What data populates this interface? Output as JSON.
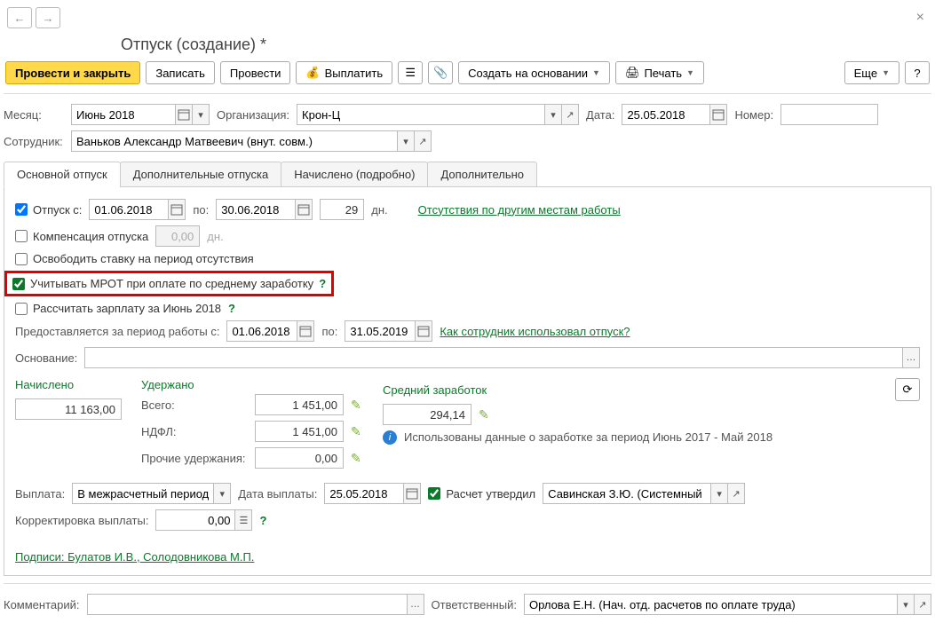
{
  "header": {
    "title": "Отпуск (создание) *"
  },
  "actions": {
    "post_close": "Провести и закрыть",
    "save": "Записать",
    "post": "Провести",
    "pay": "Выплатить",
    "create_based": "Создать на основании",
    "print": "Печать",
    "more": "Еще",
    "help": "?"
  },
  "topfields": {
    "month_l": "Месяц:",
    "month_v": "Июнь 2018",
    "org_l": "Организация:",
    "org_v": "Крон-Ц",
    "date_l": "Дата:",
    "date_v": "25.05.2018",
    "num_l": "Номер:",
    "emp_l": "Сотрудник:",
    "emp_v": "Ваньков Александр Матвеевич (внут. совм.)"
  },
  "tabs": {
    "main": "Основной отпуск",
    "add": "Дополнительные отпуска",
    "calc": "Начислено (подробно)",
    "other": "Дополнительно"
  },
  "main": {
    "vacation_l": "Отпуск  с:",
    "from": "01.06.2018",
    "to_l": "по:",
    "to": "30.06.2018",
    "days": "29",
    "days_l": "дн.",
    "absence_link": "Отсутствия по другим местам работы",
    "comp_l": "Компенсация отпуска",
    "comp_v": "0,00",
    "comp_u": "дн.",
    "release_l": "Освободить ставку на период отсутствия",
    "mrot_l": "Учитывать МРОТ при оплате по среднему заработку",
    "recalc_l": "Рассчитать зарплату за Июнь 2018",
    "period_l": "Предоставляется за период работы с:",
    "pfrom": "01.06.2018",
    "pto_l": "по:",
    "pto": "31.05.2019",
    "howused_link": "Как сотрудник использовал отпуск?",
    "reason_l": "Основание:",
    "accrued_h": "Начислено",
    "accrued_v": "11 163,00",
    "withheld_h": "Удержано",
    "total_l": "Всего:",
    "total_v": "1 451,00",
    "ndfl_l": "НДФЛ:",
    "ndfl_v": "1 451,00",
    "other_l": "Прочие удержания:",
    "other_v": "0,00",
    "avg_h": "Средний заработок",
    "avg_v": "294,14",
    "info_text": "Использованы данные о заработке за период Июнь 2017 - Май 2018",
    "payout_l": "Выплата:",
    "payout_v": "В межрасчетный период",
    "paydate_l": "Дата выплаты:",
    "paydate_v": "25.05.2018",
    "approved_l": "Расчет утвердил",
    "approver_v": "Савинская З.Ю. (Системный п",
    "corr_l": "Корректировка выплаты:",
    "corr_v": "0,00",
    "sign_link": "Подписи: Булатов И.В., Солодовникова М.П."
  },
  "bottom": {
    "comment_l": "Комментарий:",
    "resp_l": "Ответственный:",
    "resp_v": "Орлова Е.Н. (Нач. отд. расчетов по оплате труда)"
  }
}
